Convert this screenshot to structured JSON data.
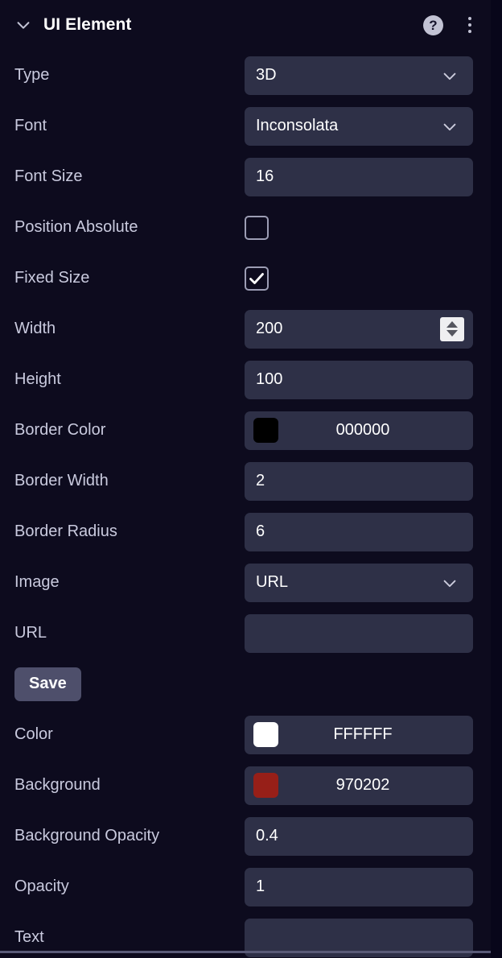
{
  "header": {
    "title": "UI Element",
    "collapse_icon": "chevron-down-icon",
    "help_icon": "help-circle-icon",
    "help_glyph": "?",
    "more_icon": "more-vertical-icon"
  },
  "colors": {
    "panel_background": "#0d0b1e",
    "field_background": "#2e3047",
    "label_text": "#c9cade",
    "value_text": "#ffffff",
    "save_button": "#4e4f6b",
    "spinner_background": "#efeff1",
    "divider": "#5a5b78"
  },
  "rows": [
    {
      "name": "type",
      "label": "Type",
      "kind": "select",
      "value": "3D"
    },
    {
      "name": "font",
      "label": "Font",
      "kind": "select",
      "value": "Inconsolata"
    },
    {
      "name": "font-size",
      "label": "Font Size",
      "kind": "text",
      "value": "16",
      "placeholder": ""
    },
    {
      "name": "position-absolute",
      "label": "Position Absolute",
      "kind": "checkbox",
      "checked": false
    },
    {
      "name": "fixed-size",
      "label": "Fixed Size",
      "kind": "checkbox",
      "checked": true
    },
    {
      "name": "width",
      "label": "Width",
      "kind": "number",
      "value": "200",
      "placeholder": "",
      "spinner": true
    },
    {
      "name": "height",
      "label": "Height",
      "kind": "text",
      "value": "100",
      "placeholder": ""
    },
    {
      "name": "border-color",
      "label": "Border Color",
      "kind": "color",
      "value": "000000",
      "swatch": "#000000"
    },
    {
      "name": "border-width",
      "label": "Border Width",
      "kind": "text",
      "value": "2",
      "placeholder": ""
    },
    {
      "name": "border-radius",
      "label": "Border Radius",
      "kind": "text",
      "value": "6",
      "placeholder": ""
    },
    {
      "name": "image",
      "label": "Image",
      "kind": "select",
      "value": "URL"
    },
    {
      "name": "url",
      "label": "URL",
      "kind": "text",
      "value": "",
      "placeholder": ""
    }
  ],
  "save": {
    "label": "Save"
  },
  "rows_after_save": [
    {
      "name": "color",
      "label": "Color",
      "kind": "color",
      "value": "FFFFFF",
      "swatch": "#ffffff"
    },
    {
      "name": "background",
      "label": "Background",
      "kind": "color",
      "value": "970202",
      "swatch": "#971f18"
    },
    {
      "name": "background-opacity",
      "label": "Background Opacity",
      "kind": "text",
      "value": "0.4",
      "placeholder": ""
    },
    {
      "name": "opacity",
      "label": "Opacity",
      "kind": "text",
      "value": "1",
      "placeholder": ""
    },
    {
      "name": "text",
      "label": "Text",
      "kind": "text",
      "value": "",
      "placeholder": ""
    }
  ]
}
